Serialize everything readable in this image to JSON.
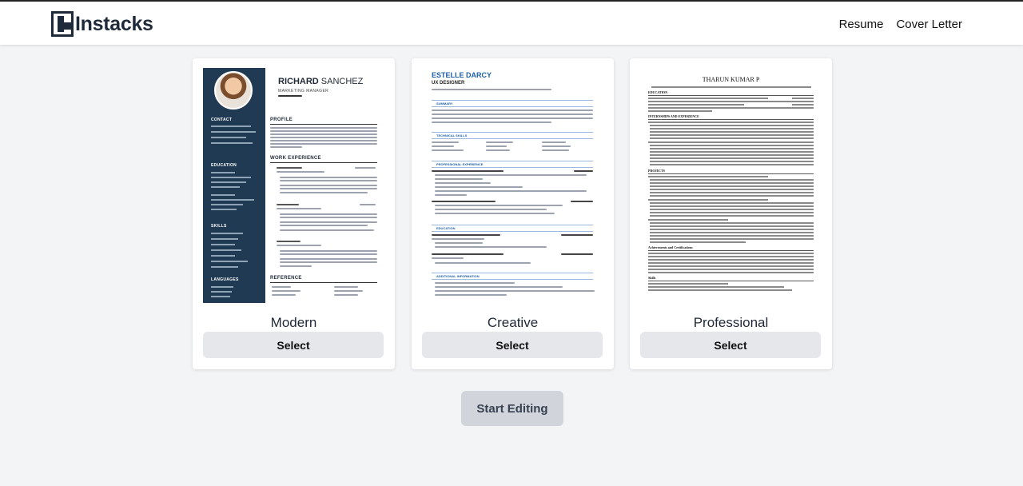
{
  "app": {
    "brand": "Instacks"
  },
  "nav": {
    "resume": "Resume",
    "cover_letter": "Cover Letter"
  },
  "templates": [
    {
      "name": "Modern",
      "select_label": "Select",
      "preview": {
        "first_name": "RICHARD",
        "last_name": "SANCHEZ",
        "role": "MARKETING MANAGER",
        "sidebar_sections": [
          "CONTACT",
          "EDUCATION",
          "SKILLS",
          "LANGUAGES"
        ],
        "main_sections": [
          "PROFILE",
          "WORK EXPERIENCE",
          "REFERENCE"
        ]
      }
    },
    {
      "name": "Creative",
      "select_label": "Select",
      "preview": {
        "name": "ESTELLE DARCY",
        "role": "UX DESIGNER",
        "sections": [
          "SUMMARY",
          "TECHNICAL SKILLS",
          "PROFESSIONAL EXPERIENCE",
          "EDUCATION",
          "ADDITIONAL INFORMATION"
        ]
      }
    },
    {
      "name": "Professional",
      "select_label": "Select",
      "preview": {
        "name": "THARUN KUMAR P",
        "sections": [
          "EDUCATION",
          "INTERNSHIPS AND EXPERIENCE",
          "PROJECTS",
          "Achievements and Certifications",
          "Skills"
        ]
      }
    }
  ],
  "actions": {
    "start_editing": "Start Editing"
  },
  "colors": {
    "modern_sidebar": "#1f3a52",
    "creative_accent": "#1e5fa8",
    "button_bg": "#e5e7eb",
    "start_bg": "#d1d5db"
  }
}
